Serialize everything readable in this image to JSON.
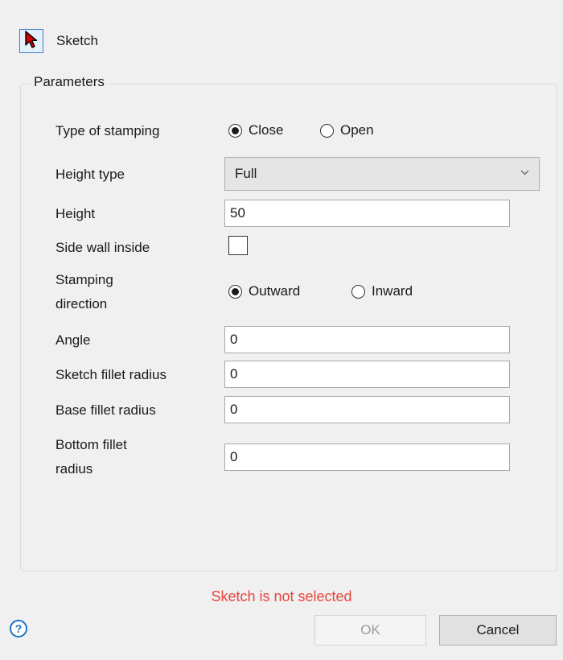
{
  "header": {
    "sketch_label": "Sketch"
  },
  "parameters": {
    "group_title": "Parameters",
    "type_of_stamping": {
      "label": "Type of stamping",
      "options": [
        "Close",
        "Open"
      ],
      "selected": "Close"
    },
    "height_type": {
      "label": "Height type",
      "value": "Full"
    },
    "height": {
      "label": "Height",
      "value": "50"
    },
    "side_wall_inside": {
      "label": "Side wall inside",
      "checked": false
    },
    "stamping_direction": {
      "label_line1": "Stamping",
      "label_line2": "direction",
      "options": [
        "Outward",
        "Inward"
      ],
      "selected": "Outward"
    },
    "angle": {
      "label": "Angle",
      "value": "0"
    },
    "sketch_fillet_radius": {
      "label": "Sketch fillet radius",
      "value": "0"
    },
    "base_fillet_radius": {
      "label": "Base fillet radius",
      "value": "0"
    },
    "bottom_fillet_radius": {
      "label_line1": "Bottom fillet",
      "label_line2": "radius",
      "value": "0"
    }
  },
  "status_message": "Sketch is not selected",
  "footer": {
    "help_glyph": "?",
    "ok_label": "OK",
    "cancel_label": "Cancel"
  },
  "colors": {
    "status": "#e8453c",
    "accent": "#1e73c4",
    "cursor_icon": "#d10000"
  },
  "icons": {
    "sketch": "cursor-arrow-icon",
    "help": "help-icon",
    "dropdown": "chevron-down-icon"
  }
}
